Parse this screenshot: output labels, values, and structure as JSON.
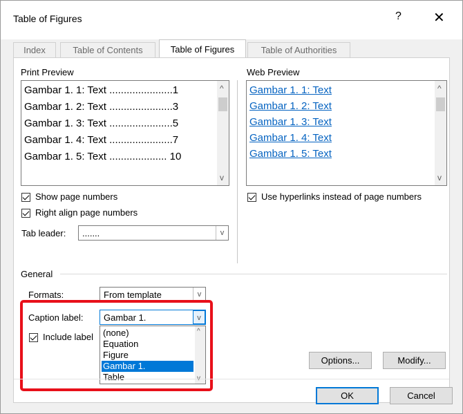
{
  "dialog": {
    "title": "Table of Figures",
    "help_icon": "?",
    "close_icon": "✕"
  },
  "tabs": [
    {
      "label": "Index"
    },
    {
      "label": "Table of Contents"
    },
    {
      "label": "Table of Figures",
      "active": true
    },
    {
      "label": "Table of Authorities"
    }
  ],
  "print_preview": {
    "label": "Print Preview",
    "rows": [
      {
        "text": "Gambar 1. 1: Text ......................1"
      },
      {
        "text": "Gambar 1. 2: Text ......................3"
      },
      {
        "text": "Gambar 1. 3: Text ......................5"
      },
      {
        "text": "Gambar 1. 4: Text ......................7"
      },
      {
        "text": "Gambar 1. 5: Text .................... 10"
      }
    ]
  },
  "web_preview": {
    "label": "Web Preview",
    "rows": [
      {
        "text": "Gambar 1. 1: Text"
      },
      {
        "text": "Gambar 1. 2: Text"
      },
      {
        "text": "Gambar 1. 3: Text"
      },
      {
        "text": "Gambar 1. 4: Text"
      },
      {
        "text": "Gambar 1. 5: Text"
      }
    ]
  },
  "options_left": {
    "show_page_numbers": {
      "label": "Show page numbers",
      "checked": true
    },
    "right_align": {
      "label": "Right align page numbers",
      "checked": true
    },
    "tab_leader": {
      "label": "Tab leader:",
      "value": "......."
    }
  },
  "options_right": {
    "use_hyperlinks": {
      "label": "Use hyperlinks instead of page numbers",
      "checked": true
    }
  },
  "general": {
    "label": "General",
    "formats": {
      "label": "Formats:",
      "value": "From template"
    },
    "caption_label": {
      "label": "Caption label:",
      "value": "Gambar 1."
    },
    "include_label": {
      "label": "Include label",
      "checked": true
    },
    "dropdown_options": [
      "(none)",
      "Equation",
      "Figure",
      "Gambar 1.",
      "Table"
    ],
    "dropdown_selected": "Gambar 1."
  },
  "buttons": {
    "options": "Options...",
    "modify": "Modify...",
    "ok": "OK",
    "cancel": "Cancel"
  },
  "colors": {
    "accent": "#0078d7",
    "highlight": "#e8101a",
    "link": "#0563c1"
  }
}
